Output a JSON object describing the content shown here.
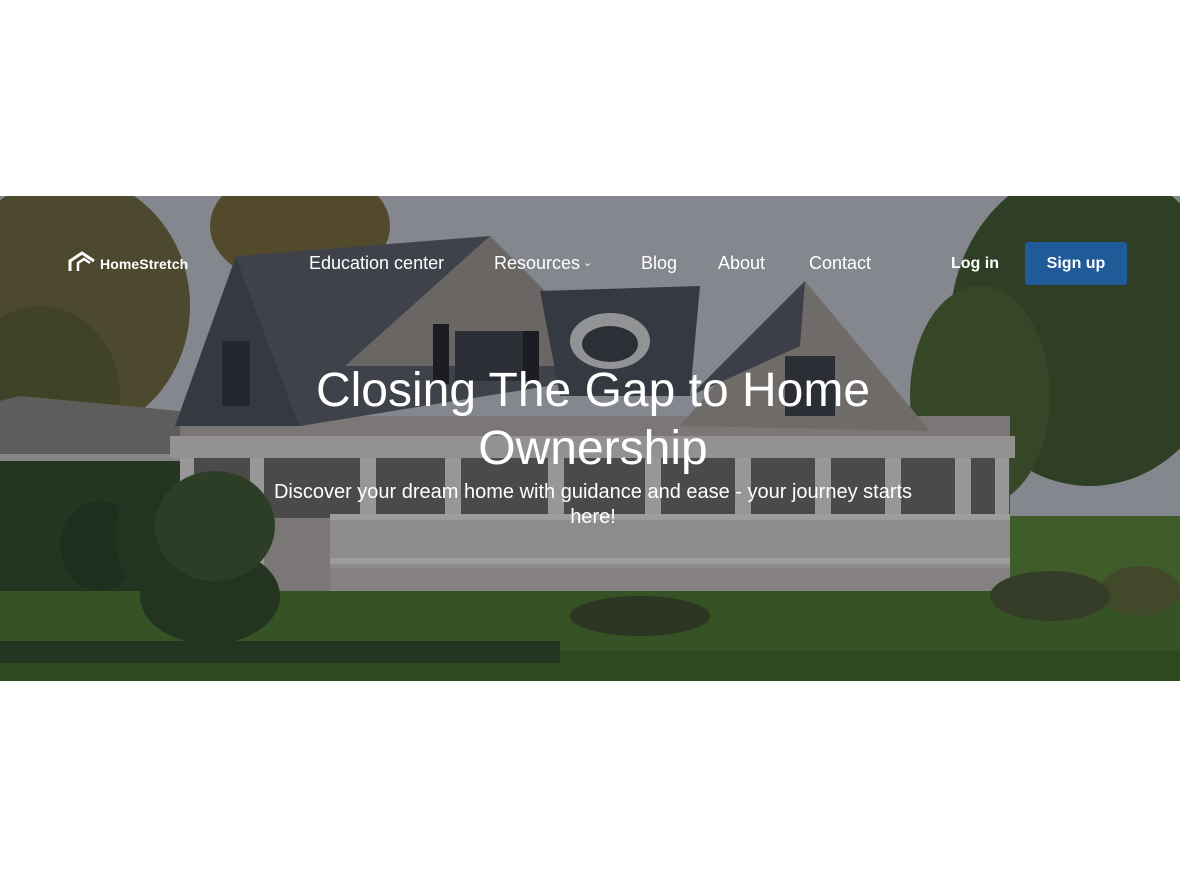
{
  "brand": {
    "name": "HomeStretch",
    "logo_icon": "house-roof-icon"
  },
  "nav": {
    "items": [
      {
        "label": "Education center"
      },
      {
        "label": "Resources",
        "has_dropdown": true,
        "dropdown_icon": "chevron-down-icon"
      },
      {
        "label": "Blog"
      },
      {
        "label": "About"
      },
      {
        "label": "Contact"
      }
    ],
    "login_label": "Log in",
    "signup_label": "Sign up"
  },
  "hero": {
    "title": "Closing The Gap to Home Ownership",
    "subtitle": "Discover your dream home with guidance and ease - your journey starts here!",
    "background_image": "house-photo"
  },
  "colors": {
    "accent": "#1f5a99",
    "text_on_hero": "#ffffff",
    "page_background": "#ffffff"
  }
}
